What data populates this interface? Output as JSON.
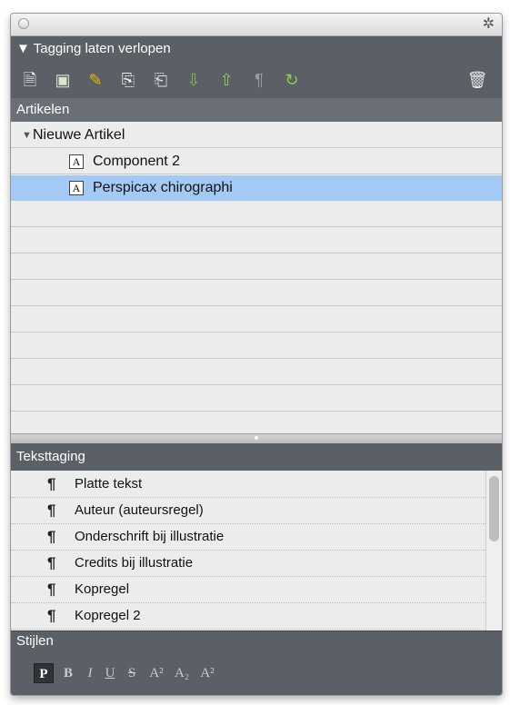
{
  "panel": {
    "title": "Tagging laten verlopen"
  },
  "toolbar": {
    "tools": [
      {
        "name": "new-document-icon",
        "glyph": "🗎",
        "color": "#f2f2f2"
      },
      {
        "name": "add-image-icon",
        "glyph": "▣",
        "color": "#d8e6d0"
      },
      {
        "name": "pencil-icon",
        "glyph": "✎",
        "color": "#f2b600"
      },
      {
        "name": "import-icon",
        "glyph": "⎘",
        "color": "#f2f2f2"
      },
      {
        "name": "export-icon",
        "glyph": "⎗",
        "color": "#e0e0e0"
      },
      {
        "name": "move-down-icon",
        "glyph": "⇩",
        "color": "#7cbf45"
      },
      {
        "name": "move-up-icon",
        "glyph": "⇧",
        "color": "#8bd14b"
      },
      {
        "name": "paragraph-icon",
        "glyph": "¶",
        "color": "#9a9da2"
      },
      {
        "name": "refresh-icon",
        "glyph": "↻",
        "color": "#8bd14b"
      }
    ],
    "trash_icon": {
      "name": "trash-icon",
      "glyph": "🗑",
      "color": "#e8e8e8"
    }
  },
  "articles": {
    "header": "Artikelen",
    "parent": "Nieuwe Artikel",
    "components": [
      {
        "label": "Component 2",
        "type_glyph": "A",
        "selected": false
      },
      {
        "label": "Perspicax chirographi",
        "type_glyph": "A",
        "selected": true
      }
    ]
  },
  "text_tagging": {
    "header": "Teksttaging",
    "items": [
      "Platte tekst",
      "Auteur (auteursregel)",
      "Onderschrift bij illustratie",
      "Credits bij illustratie",
      "Kopregel",
      "Kopregel 2"
    ],
    "scroll_position": 0.0
  },
  "styles": {
    "header": "Stijlen",
    "buttons": [
      {
        "name": "plain-style-button",
        "glyph": "P",
        "active": true
      },
      {
        "name": "bold-style-button",
        "glyph": "B",
        "active": false
      },
      {
        "name": "italic-style-button",
        "glyph": "I",
        "active": false
      },
      {
        "name": "underline-style-button",
        "glyph": "U",
        "active": false
      },
      {
        "name": "strikethrough-style-button",
        "glyph": "S",
        "active": false
      },
      {
        "name": "superscript-style-button",
        "glyph": "A²",
        "active": false
      },
      {
        "name": "subscript-style-button",
        "glyph": "A₂",
        "active": false
      },
      {
        "name": "superscript-alt-style-button",
        "glyph": "A²",
        "active": false
      }
    ]
  },
  "colors": {
    "selection": "#a3c9f5",
    "header_bg": "#5b5f66"
  }
}
